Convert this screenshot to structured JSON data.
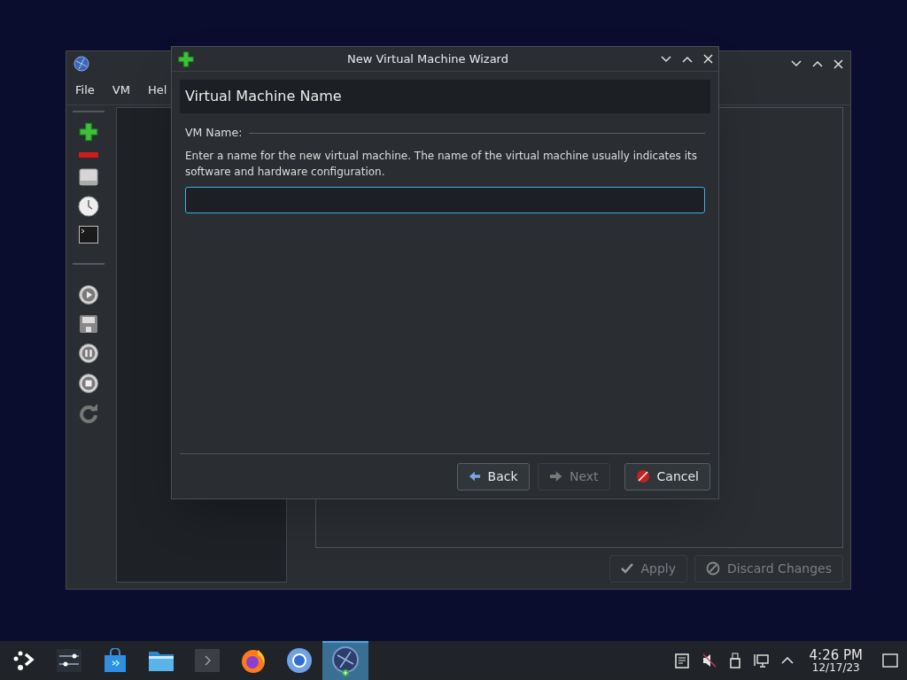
{
  "main_window": {
    "menu": [
      "File",
      "VM",
      "Hel"
    ],
    "toolbar": [
      {
        "kind": "add"
      },
      {
        "kind": "remove"
      },
      {
        "kind": "disk"
      },
      {
        "kind": "clock"
      },
      {
        "kind": "terminal"
      },
      {
        "kind": "separator"
      },
      {
        "kind": "play"
      },
      {
        "kind": "save"
      },
      {
        "kind": "pause"
      },
      {
        "kind": "stop"
      },
      {
        "kind": "refresh"
      }
    ],
    "buttons": [
      {
        "label": "Apply",
        "kind": "apply",
        "disabled": true
      },
      {
        "label": "Discard Changes",
        "kind": "discard",
        "disabled": true
      }
    ]
  },
  "dialog": {
    "title": "New Virtual Machine Wizard",
    "page_title": "Virtual Machine Name",
    "group_label": "VM Name:",
    "description": "Enter a name for the new virtual machine. The name of the virtual machine usually indicates its software and hardware configuration.",
    "name_field": {
      "focused": true
    },
    "buttons": [
      {
        "label": "Back",
        "kind": "back",
        "disabled": false
      },
      {
        "label": "Next",
        "kind": "next",
        "disabled": true
      },
      {
        "label": "Cancel",
        "kind": "cancel",
        "disabled": false
      }
    ]
  },
  "taskbar": {
    "apps": [
      {
        "kind": "launcher",
        "selected": false
      },
      {
        "kind": "settings",
        "selected": false
      },
      {
        "kind": "store",
        "selected": false
      },
      {
        "kind": "files",
        "selected": false
      },
      {
        "kind": "terminal",
        "selected": false
      },
      {
        "kind": "firefox",
        "selected": false
      },
      {
        "kind": "chromium",
        "selected": false
      },
      {
        "kind": "vm",
        "selected": true
      }
    ],
    "tray": [
      {
        "kind": "clipboard"
      },
      {
        "kind": "muted"
      },
      {
        "kind": "usb"
      },
      {
        "kind": "network"
      },
      {
        "kind": "expand"
      }
    ],
    "time": "4:26 PM",
    "date": "12/17/23"
  }
}
